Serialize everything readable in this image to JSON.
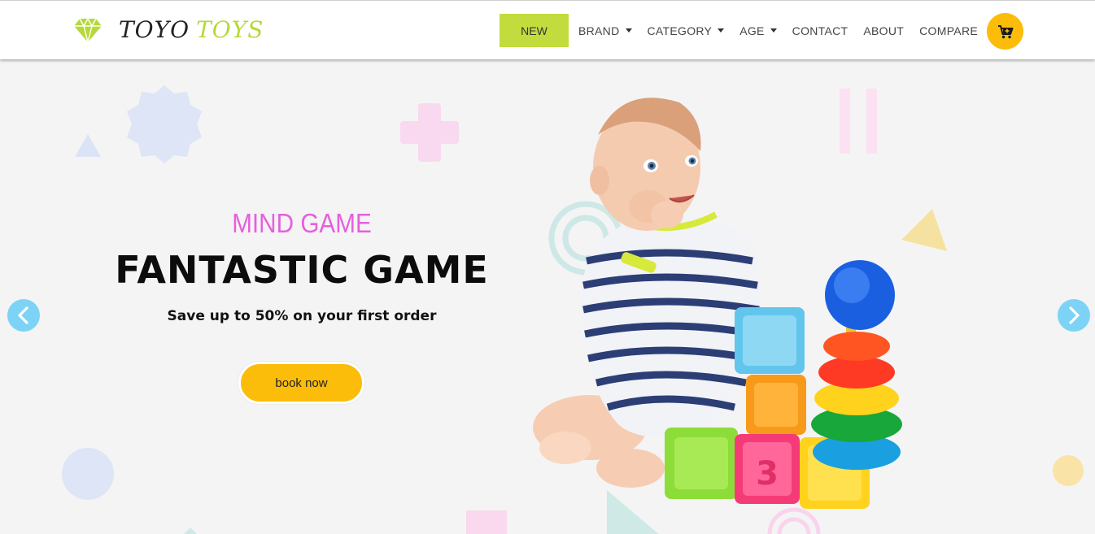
{
  "brand": {
    "word1": "TOYO",
    "word2": "TOYS",
    "icon": "diamond-icon",
    "accent_color": "#c3dc3d"
  },
  "nav": {
    "new_label": "NEW",
    "items": [
      {
        "label": "BRAND",
        "dropdown": true
      },
      {
        "label": "CATEGORY",
        "dropdown": true
      },
      {
        "label": "AGE",
        "dropdown": true
      },
      {
        "label": "CONTACT",
        "dropdown": false
      },
      {
        "label": "ABOUT",
        "dropdown": false
      },
      {
        "label": "COMPARE",
        "dropdown": false
      }
    ],
    "cart_icon": "cart-icon",
    "cart_color": "#fbbc0a"
  },
  "hero": {
    "subtitle": "MIND GAME",
    "title": "FANTASTIC GAME",
    "description": "Save up to 50% on your first order",
    "cta_label": "book now",
    "subtitle_color": "#e660dc",
    "cta_color": "#fbbc0a",
    "prev_icon": "chevron-left-icon",
    "next_icon": "chevron-right-icon",
    "image": "baby-with-toys-image"
  }
}
